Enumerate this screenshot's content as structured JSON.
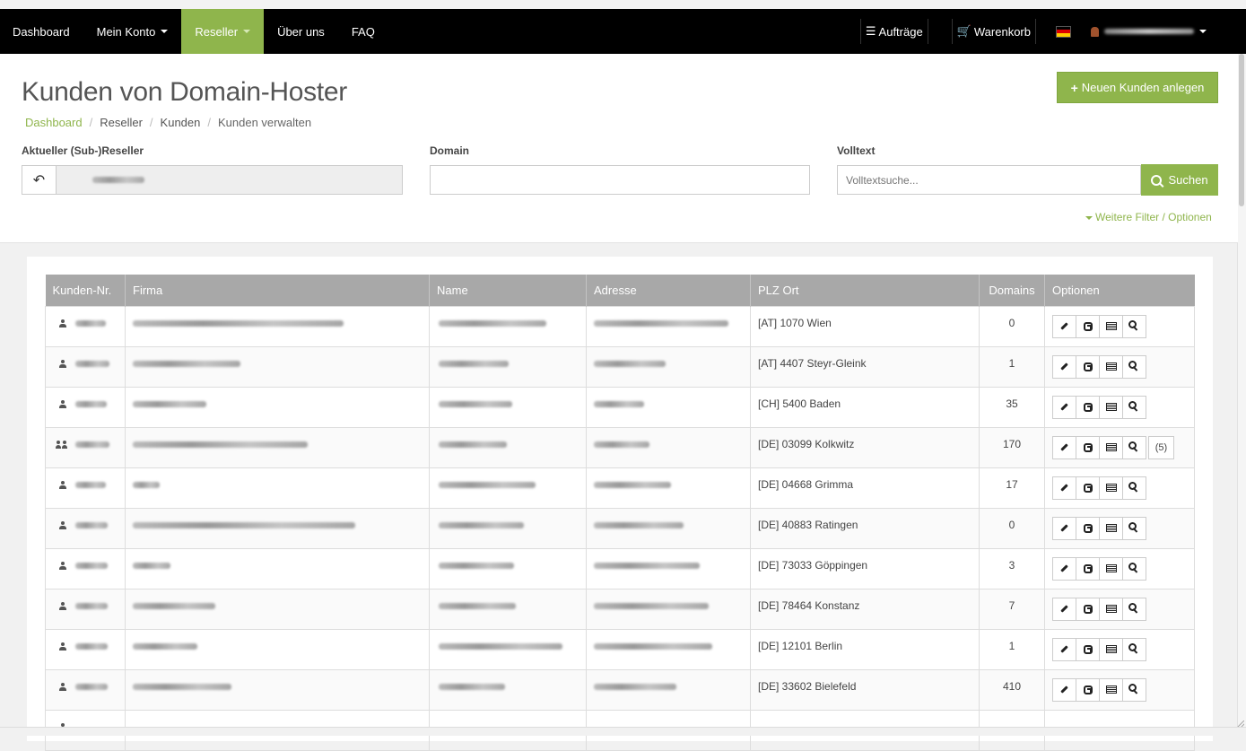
{
  "nav": {
    "items": [
      {
        "label": "Dashboard",
        "dropdown": false,
        "active": false
      },
      {
        "label": "Mein Konto",
        "dropdown": true,
        "active": false
      },
      {
        "label": "Reseller",
        "dropdown": true,
        "active": true
      },
      {
        "label": "Über uns",
        "dropdown": false,
        "active": false
      },
      {
        "label": "FAQ",
        "dropdown": false,
        "active": false
      }
    ],
    "orders_label": "Aufträge",
    "cart_label": "Warenkorb",
    "flag_colors": [
      "#000000",
      "#dd0000",
      "#ffce00"
    ]
  },
  "page": {
    "title": "Kunden von Domain-Hoster",
    "new_customer_label": "Neuen Kunden anlegen",
    "breadcrumb": [
      "Dashboard",
      "Reseller",
      "Kunden",
      "Kunden verwalten"
    ]
  },
  "filters": {
    "reseller_label": "Aktueller (Sub-)Reseller",
    "domain_label": "Domain",
    "volltext_label": "Volltext",
    "volltext_placeholder": "Volltextsuche...",
    "search_label": "Suchen",
    "more_filters_label": "Weitere Filter / Optionen"
  },
  "table": {
    "columns": [
      "Kunden-Nr.",
      "Firma",
      "Name",
      "Adresse",
      "PLZ Ort",
      "Domains",
      "Optionen"
    ],
    "rows": [
      {
        "type": "person",
        "plz_ort": "[AT] 1070 Wien",
        "domains": "0",
        "count": ""
      },
      {
        "type": "person",
        "plz_ort": "[AT] 4407 Steyr-Gleink",
        "domains": "1",
        "count": ""
      },
      {
        "type": "person",
        "plz_ort": "[CH] 5400 Baden",
        "domains": "35",
        "count": ""
      },
      {
        "type": "group",
        "plz_ort": "[DE] 03099 Kolkwitz",
        "domains": "170",
        "count": "(5)"
      },
      {
        "type": "person",
        "plz_ort": "[DE] 04668 Grimma",
        "domains": "17",
        "count": ""
      },
      {
        "type": "person",
        "plz_ort": "[DE] 40883 Ratingen",
        "domains": "0",
        "count": ""
      },
      {
        "type": "person",
        "plz_ort": "[DE] 73033 Göppingen",
        "domains": "3",
        "count": ""
      },
      {
        "type": "person",
        "plz_ort": "[DE] 78464 Konstanz",
        "domains": "7",
        "count": ""
      },
      {
        "type": "person",
        "plz_ort": "[DE] 12101 Berlin",
        "domains": "1",
        "count": ""
      },
      {
        "type": "person",
        "plz_ort": "[DE] 33602 Bielefeld",
        "domains": "410",
        "count": ""
      }
    ]
  },
  "theme": {
    "accent": "#8fb54c",
    "navbar": "#000000",
    "table_header": "#a8a8a8"
  }
}
